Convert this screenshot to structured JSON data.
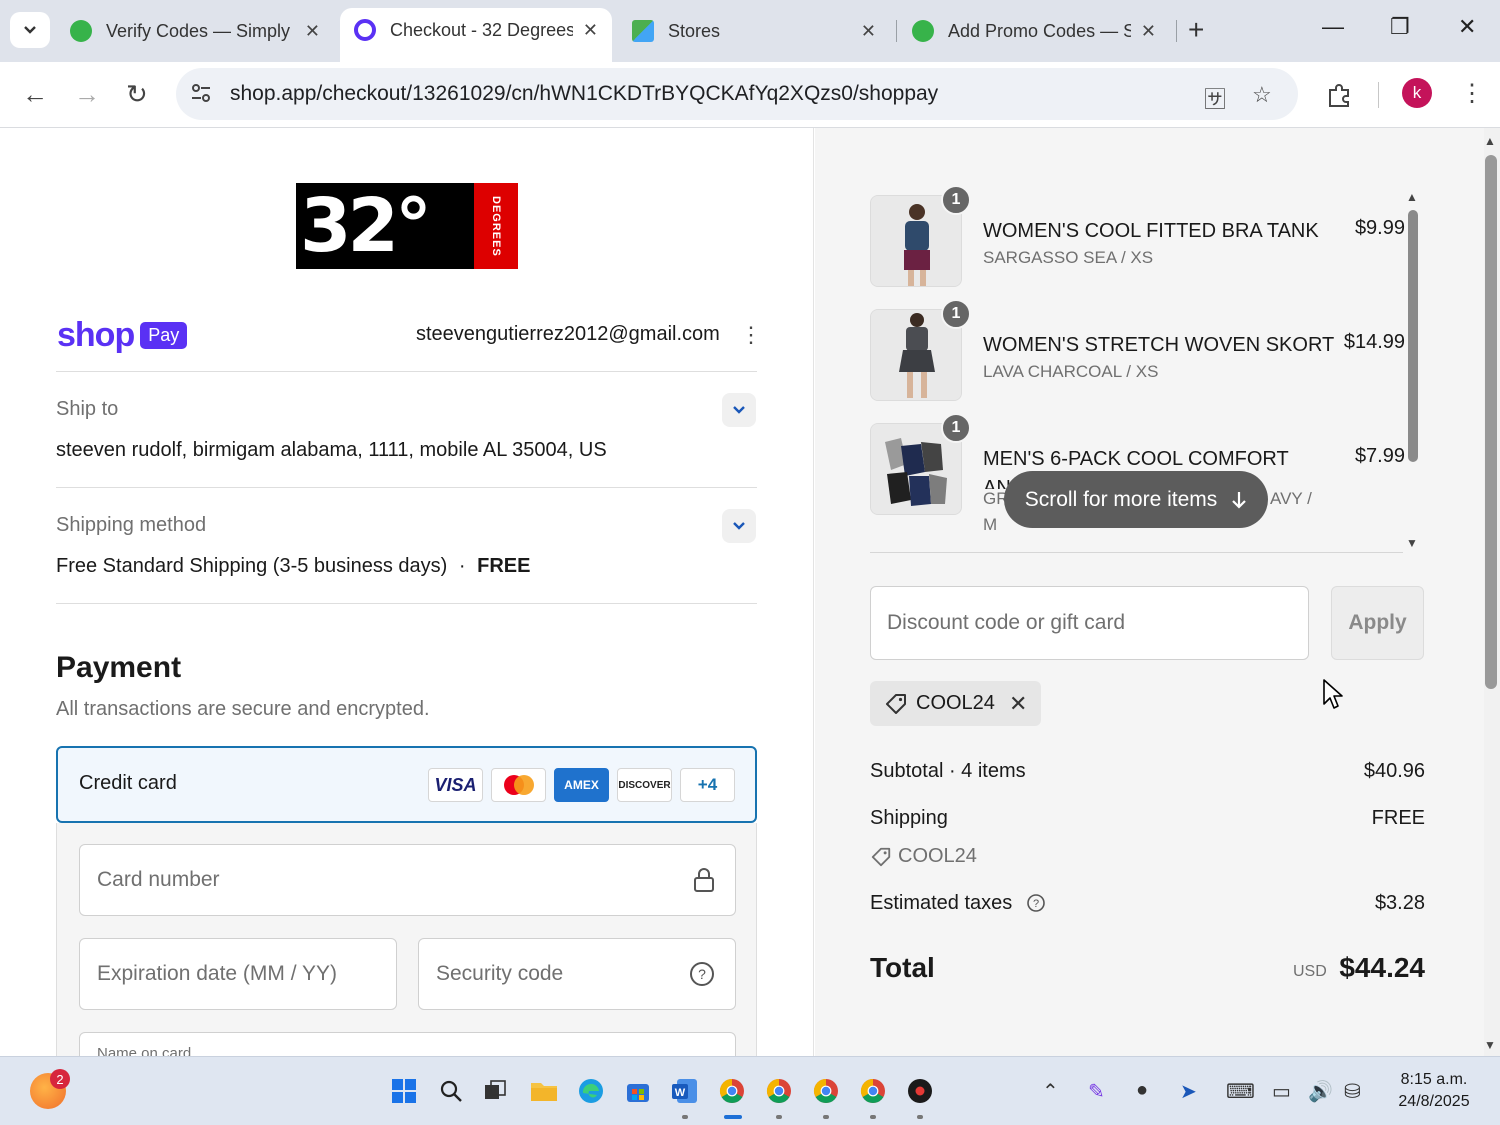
{
  "browser": {
    "tabs": [
      {
        "title": "Verify Codes — Simply",
        "active": false
      },
      {
        "title": "Checkout - 32 Degrees",
        "active": true
      },
      {
        "title": "Stores",
        "active": false
      },
      {
        "title": "Add Promo Codes — S",
        "active": false
      }
    ],
    "url": "shop.app/checkout/13261029/cn/hWN1CKDTrBYQCKAfYq2XQzs0/shoppay",
    "profile_initial": "k"
  },
  "store": {
    "logo_text": "32°",
    "logo_tag": "DEGREES"
  },
  "shop_pay": {
    "brand": "shop",
    "badge": "Pay",
    "email": "steevengutierrez2012@gmail.com"
  },
  "ship_to": {
    "label": "Ship to",
    "value": "steeven rudolf, birmigam alabama, 1111, mobile AL 35004, US"
  },
  "shipping_method": {
    "label": "Shipping method",
    "value": "Free Standard Shipping (3-5 business days)",
    "separator": "·",
    "price": "FREE"
  },
  "payment": {
    "title": "Payment",
    "subtitle": "All transactions are secure and encrypted.",
    "method_label": "Credit card",
    "card_brands": [
      "VISA",
      "Mastercard",
      "AMEX",
      "DISCOVER",
      "+4"
    ],
    "card_number_placeholder": "Card number",
    "expiration_placeholder": "Expiration date (MM / YY)",
    "security_placeholder": "Security code",
    "name_label": "Name on card"
  },
  "order": {
    "items": [
      {
        "qty": "1",
        "name": "WOMEN'S COOL FITTED BRA TANK",
        "variant": "SARGASSO SEA / XS",
        "price": "$9.99"
      },
      {
        "qty": "1",
        "name": "WOMEN'S STRETCH WOVEN SKORT",
        "variant": "LAVA CHARCOAL / XS",
        "price": "$14.99"
      },
      {
        "qty": "1",
        "name": "MEN'S 6-PACK COOL COMFORT ANKLE RUNNING SOCKS",
        "variant_start": "GR",
        "variant_end": "AVY /",
        "variant_size": "M",
        "price": "$7.99"
      }
    ],
    "scroll_hint": "Scroll for more items"
  },
  "discount": {
    "placeholder": "Discount code or gift card",
    "apply_label": "Apply",
    "applied_code": "COOL24"
  },
  "summary": {
    "subtotal_label": "Subtotal · 4 items",
    "subtotal_value": "$40.96",
    "shipping_label": "Shipping",
    "shipping_value": "FREE",
    "discount_code": "COOL24",
    "taxes_label": "Estimated taxes",
    "taxes_value": "$3.28",
    "total_label": "Total",
    "currency": "USD",
    "total_value": "$44.24"
  },
  "taskbar": {
    "notification_count": "2",
    "time": "8:15 a.m.",
    "date": "24/8/2025"
  },
  "colors": {
    "shop_pay_purple": "#5a31f4",
    "selected_border": "#1773b0",
    "logo_red": "#dd0000"
  }
}
